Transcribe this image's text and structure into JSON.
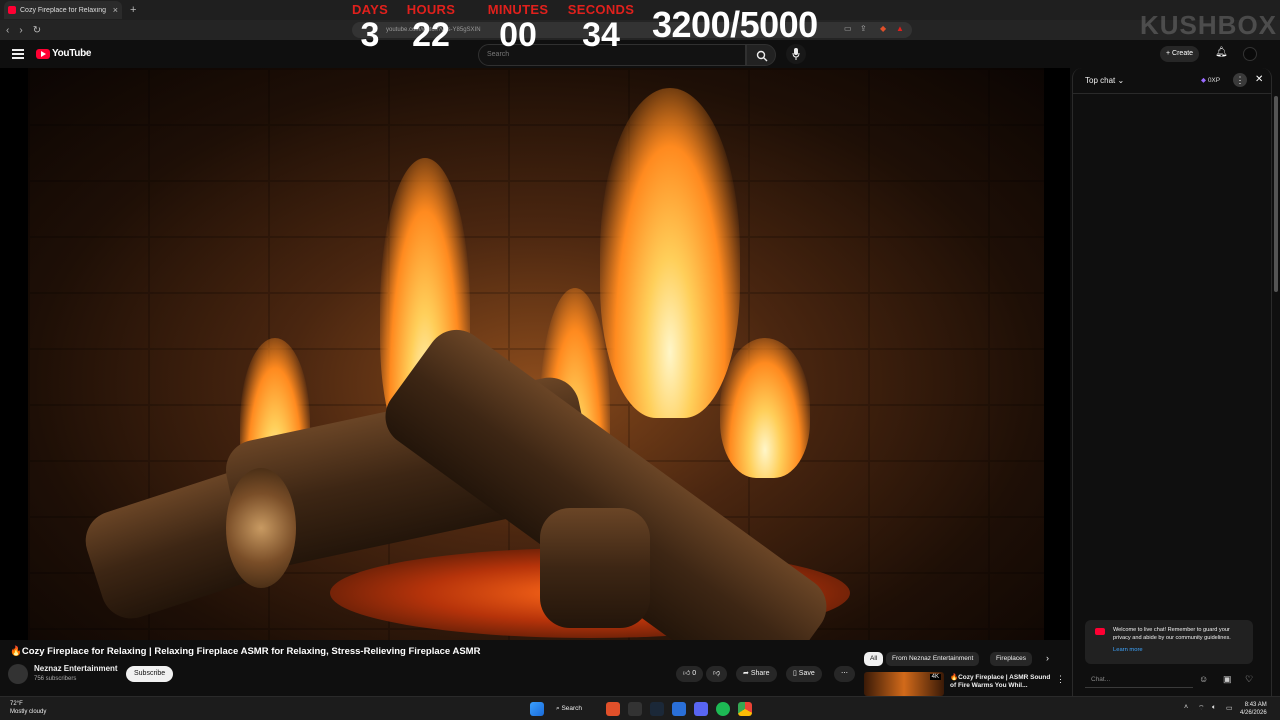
{
  "browser": {
    "tab_title": "Cozy Fireplace for Relaxing",
    "tab_close": "×",
    "new_tab": "+",
    "nav_back": "‹",
    "nav_forward": "›",
    "nav_reload": "↻",
    "url": "youtube.com/watch?v=s-Y85gSXIN"
  },
  "header": {
    "logo_text": "YouTube",
    "search_placeholder": "Search",
    "create_label": "Create"
  },
  "countdown": {
    "days_label": "DAYS",
    "days_value": "3",
    "hours_label": "HOURS",
    "hours_value": "22",
    "minutes_label": "MINUTES",
    "minutes_value": "00",
    "seconds_label": "SECONDS",
    "seconds_value": "34",
    "progress_text": "3200/5000",
    "label_color": "#e0201c"
  },
  "watermark": "KUSHBOX",
  "video": {
    "title": "🔥Cozy Fireplace for Relaxing | Relaxing Fireplace ASMR for Relaxing, Stress-Relieving Fireplace ASMR",
    "channel_name": "Neznaz Entertainment",
    "subscribers": "756 subscribers",
    "subscribe_label": "Subscribe",
    "like_count": "0",
    "share_label": "Share",
    "save_label": "Save"
  },
  "recommendations": {
    "chips": [
      "All",
      "From Neznaz Entertainment",
      "Fireplaces"
    ],
    "first_title": "🔥Cozy Fireplace | ASMR Sound of Fire Warms You Whil...",
    "first_badge": "4K"
  },
  "chat": {
    "mode_label": "Top chat",
    "xp_label": "0XP",
    "welcome_text": "Welcome to live chat! Remember to guard your privacy and abide by our community guidelines.",
    "learn_more": "Learn more",
    "input_placeholder": "Chat..."
  },
  "taskbar": {
    "temperature": "72°F",
    "weather": "Mostly cloudy",
    "search_label": "Search",
    "time": "8:43 AM",
    "date": "4/26/2026"
  },
  "colors": {
    "yt_red": "#ff0033",
    "link_blue": "#3ea6ff",
    "background": "#0f0f0f"
  }
}
